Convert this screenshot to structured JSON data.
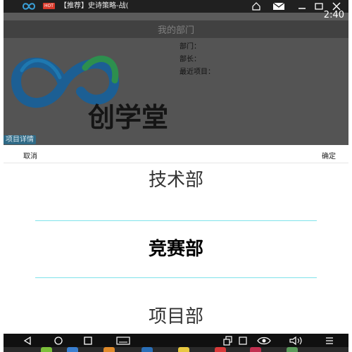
{
  "status_bar": {
    "hot_badge": "HOT",
    "notification": "【推荐】史诗策略-战(",
    "time": "2:40"
  },
  "header": {
    "title": "我的部门"
  },
  "brand": {
    "logo_text": "创学堂"
  },
  "info": {
    "department_label": "部门：",
    "manager_label": "部长：",
    "recent_project_label": "最近项目："
  },
  "detail_button": "项目详情",
  "picker": {
    "cancel_label": "取消",
    "confirm_label": "确定",
    "options": [
      "技术部",
      "竞赛部",
      "项目部"
    ],
    "selected": "竞赛部"
  },
  "colors": {
    "selection_line": "#7fe3ea",
    "detail_button": "#2f6a86",
    "hot_badge": "#d93a2b"
  }
}
